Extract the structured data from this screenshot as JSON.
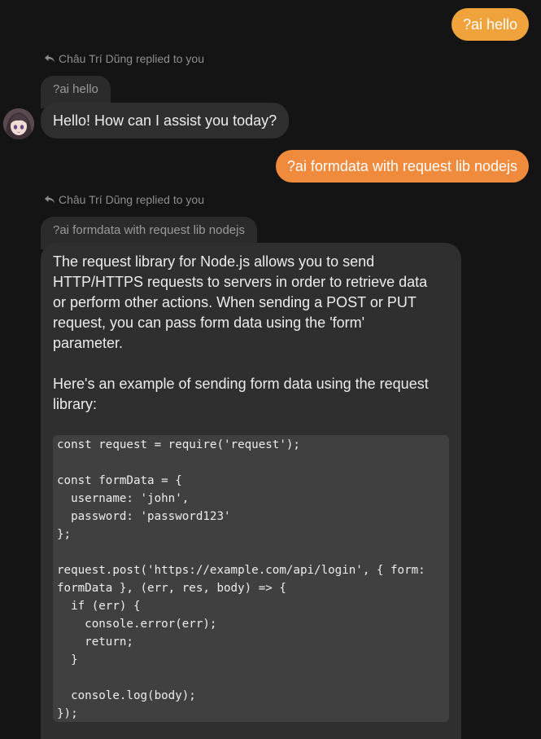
{
  "messages": [
    {
      "text": "?ai hello",
      "color": "#f0a23c"
    },
    {
      "text": "?ai formdata with request lib nodejs",
      "color": "#f08a3c"
    }
  ],
  "replies": [
    {
      "meta": "Châu Trí Dũng replied to you",
      "quote": "?ai hello",
      "text": "Hello! How can I assist you today?"
    },
    {
      "meta": "Châu Trí Dũng replied to you",
      "quote": "?ai formdata with request lib nodejs",
      "paragraph1": "The request library for Node.js allows you to send\nHTTP/HTTPS requests to servers in order to retrieve data\nor perform other actions. When sending a POST or PUT\nrequest, you can pass form data using the 'form'\nparameter.",
      "paragraph2": "Here's an example of sending form data using the request\nlibrary:",
      "code": "const request = require('request');\n\nconst formData = {\n  username: 'john',\n  password: 'password123'\n};\n\nrequest.post('https://example.com/api/login', { form:\nformData }, (err, res, body) => {\n  if (err) {\n    console.error(err);\n    return;\n  }\n\n  console.log(body);\n});"
    }
  ],
  "icons": {
    "reply": "reply-arrow-icon",
    "avatar": "user-avatar"
  }
}
